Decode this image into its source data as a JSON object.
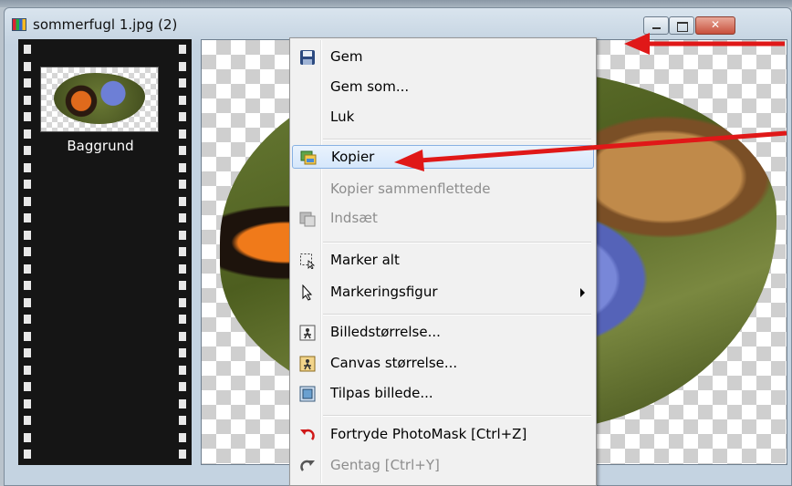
{
  "window": {
    "title": "sommerfugl 1.jpg (2)",
    "close_glyph": "✕"
  },
  "filmstrip": {
    "layer_label": "Baggrund"
  },
  "menu": {
    "items": [
      {
        "label": "Gem",
        "icon": "floppy-disk-icon",
        "enabled": true
      },
      {
        "label": "Gem som...",
        "enabled": true
      },
      {
        "label": "Luk",
        "enabled": true
      },
      {
        "label": "Kopier",
        "icon": "copy-image-icon",
        "enabled": true,
        "highlighted": true
      },
      {
        "label": "Kopier sammenflettede",
        "enabled": false
      },
      {
        "label": "Indsæt",
        "icon": "paste-icon",
        "enabled": false
      },
      {
        "label": "Marker alt",
        "icon": "select-all-icon",
        "enabled": true
      },
      {
        "label": "Markeringsfigur",
        "icon": "pointer-icon",
        "enabled": true,
        "submenu": true
      },
      {
        "label": "Billedstørrelse...",
        "icon": "image-size-icon",
        "enabled": true
      },
      {
        "label": "Canvas størrelse...",
        "icon": "canvas-size-icon",
        "enabled": true
      },
      {
        "label": "Tilpas billede...",
        "icon": "fit-image-icon",
        "enabled": true
      },
      {
        "label": "Fortryde PhotoMask [Ctrl+Z]",
        "icon": "undo-icon",
        "enabled": true
      },
      {
        "label": "Gentag [Ctrl+Y]",
        "icon": "redo-icon",
        "enabled": false
      }
    ]
  },
  "colors": {
    "annotation_arrow": "#e01818",
    "highlight_border": "#88b1e3"
  }
}
